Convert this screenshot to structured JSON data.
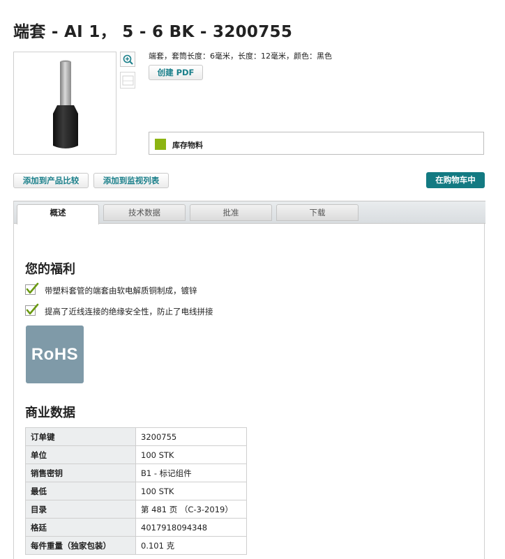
{
  "title": "端套 - AI 1， 5 - 6 BK - 3200755",
  "icons": {
    "zoom": "zoom-in-icon",
    "thumbnail": "thumbnail-icon",
    "check": "checkmark-icon"
  },
  "colors": {
    "accent": "#1a7f8a",
    "cart_button": "#137a82",
    "stock_indicator": "#8cb412",
    "rohs_badge": "#7f9aa8"
  },
  "product": {
    "short_description": "端套，套筒长度：6毫米，长度：12毫米，颜色：黑色",
    "create_pdf_label": "创建 PDF",
    "stock_label": "库存物料"
  },
  "actions": {
    "add_compare": "添加到产品比较",
    "add_watchlist": "添加到监视列表",
    "cart": "在购物车中"
  },
  "tabs": [
    {
      "label": "概述",
      "active": true
    },
    {
      "label": "技术数据",
      "active": false
    },
    {
      "label": "批准",
      "active": false
    },
    {
      "label": "下载",
      "active": false
    }
  ],
  "benefits": {
    "title": "您的福利",
    "items": [
      "带塑料套管的端套由软电解质铜制成，镀锌",
      "提高了近线连接的绝缘安全性，防止了电线拼接"
    ],
    "rohs_label": "RoHS"
  },
  "commercial": {
    "title": "商业数据",
    "rows": [
      {
        "key": "订单键",
        "value": "3200755"
      },
      {
        "key": "单位",
        "value": "100 STK"
      },
      {
        "key": "销售密钥",
        "value": "B1 - 标记组件"
      },
      {
        "key": "最低",
        "value": "100 STK"
      },
      {
        "key": "目录",
        "value": "第 481 页 （C-3-2019）"
      },
      {
        "key": "格廷",
        "value": "4017918094348"
      },
      {
        "key": "每件重量（独家包装）",
        "value": "0.101 克"
      }
    ]
  }
}
